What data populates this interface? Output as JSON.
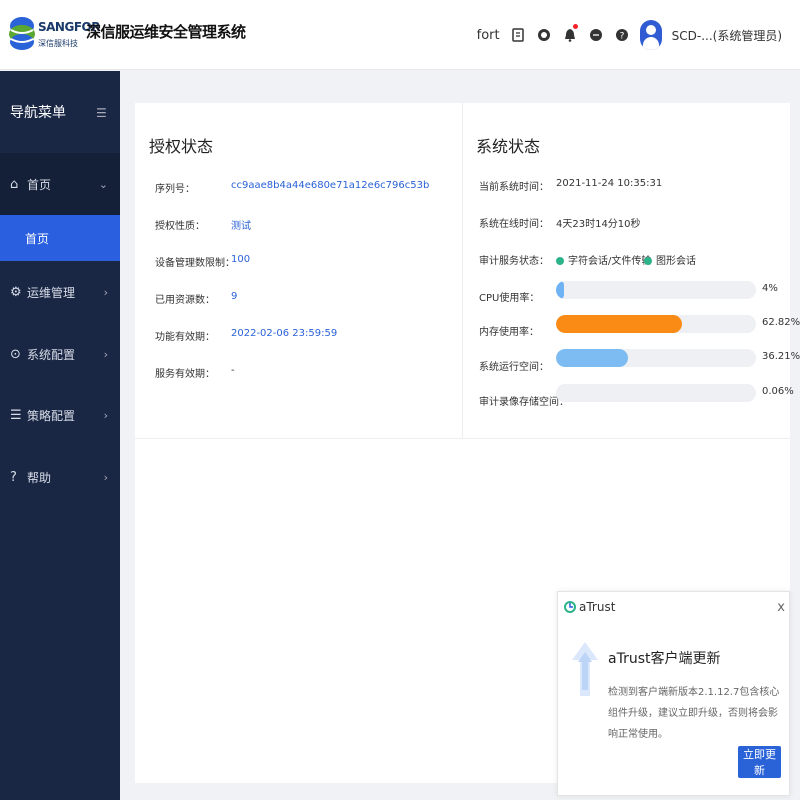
{
  "header": {
    "brand": "SANGFOR",
    "brand_cn": "深信服科技",
    "title": "深信服运维安全管理系统",
    "fort_label": "fort",
    "user_label": "SCD-...(系统管理员)"
  },
  "sidebar": {
    "heading": "导航菜单",
    "items": [
      {
        "label": "首页",
        "icon": "home-icon"
      },
      {
        "label": "运维管理",
        "icon": "gear-icon"
      },
      {
        "label": "系统配置",
        "icon": "settings-icon"
      },
      {
        "label": "策略配置",
        "icon": "list-icon"
      },
      {
        "label": "帮助",
        "icon": "help-icon"
      }
    ],
    "sub_item": "首页"
  },
  "license": {
    "title": "授权状态",
    "rows": [
      {
        "label": "序列号：",
        "value": "cc9aae8b4a44e680e71a12e6c796c53b"
      },
      {
        "label": "授权性质：",
        "value": "测试"
      },
      {
        "label": "设备管理数限制：",
        "value": "100"
      },
      {
        "label": "已用资源数：",
        "value": "9"
      },
      {
        "label": "功能有效期：",
        "value": "2022-02-06 23:59:59"
      },
      {
        "label": "服务有效期：",
        "value": "-"
      }
    ]
  },
  "system": {
    "title": "系统状态",
    "time_label": "当前系统时间：",
    "time_value": "2021-11-24 10:35:31",
    "uptime_label": "系统在线时间：",
    "uptime_value": "4天23时14分10秒",
    "audit_label": "审计服务状态：",
    "audit_services": [
      "字符会话/文件传输",
      "图形会话"
    ],
    "audit_color": "#2bb38a",
    "bars": [
      {
        "label": "CPU使用率：",
        "percent_text": "4%",
        "value": 0.04,
        "color": "#6fb3f5"
      },
      {
        "label": "内存使用率：",
        "percent_text": "62.82%",
        "value": 0.6282,
        "color": "#fa8c16"
      },
      {
        "label": "系统运行空间：",
        "percent_text": "36.21%",
        "value": 0.3621,
        "color": "#7cbcf2"
      },
      {
        "label": "审计录像存储空间：",
        "percent_text": "0.06%",
        "value": 0.0006,
        "color": "#6fb3f5"
      }
    ]
  },
  "popup": {
    "brand": "aTrust",
    "close": "x",
    "title": "aTrust客户端更新",
    "message": "检测到客户端新版本2.1.12.7包含核心组件升级，建议立即升级，否则将会影响正常使用。",
    "button": "立即更新"
  },
  "colors": {
    "sidebar_bg": "#1a2744",
    "active_bg": "#2a5fe0",
    "link": "#2a62d8"
  }
}
